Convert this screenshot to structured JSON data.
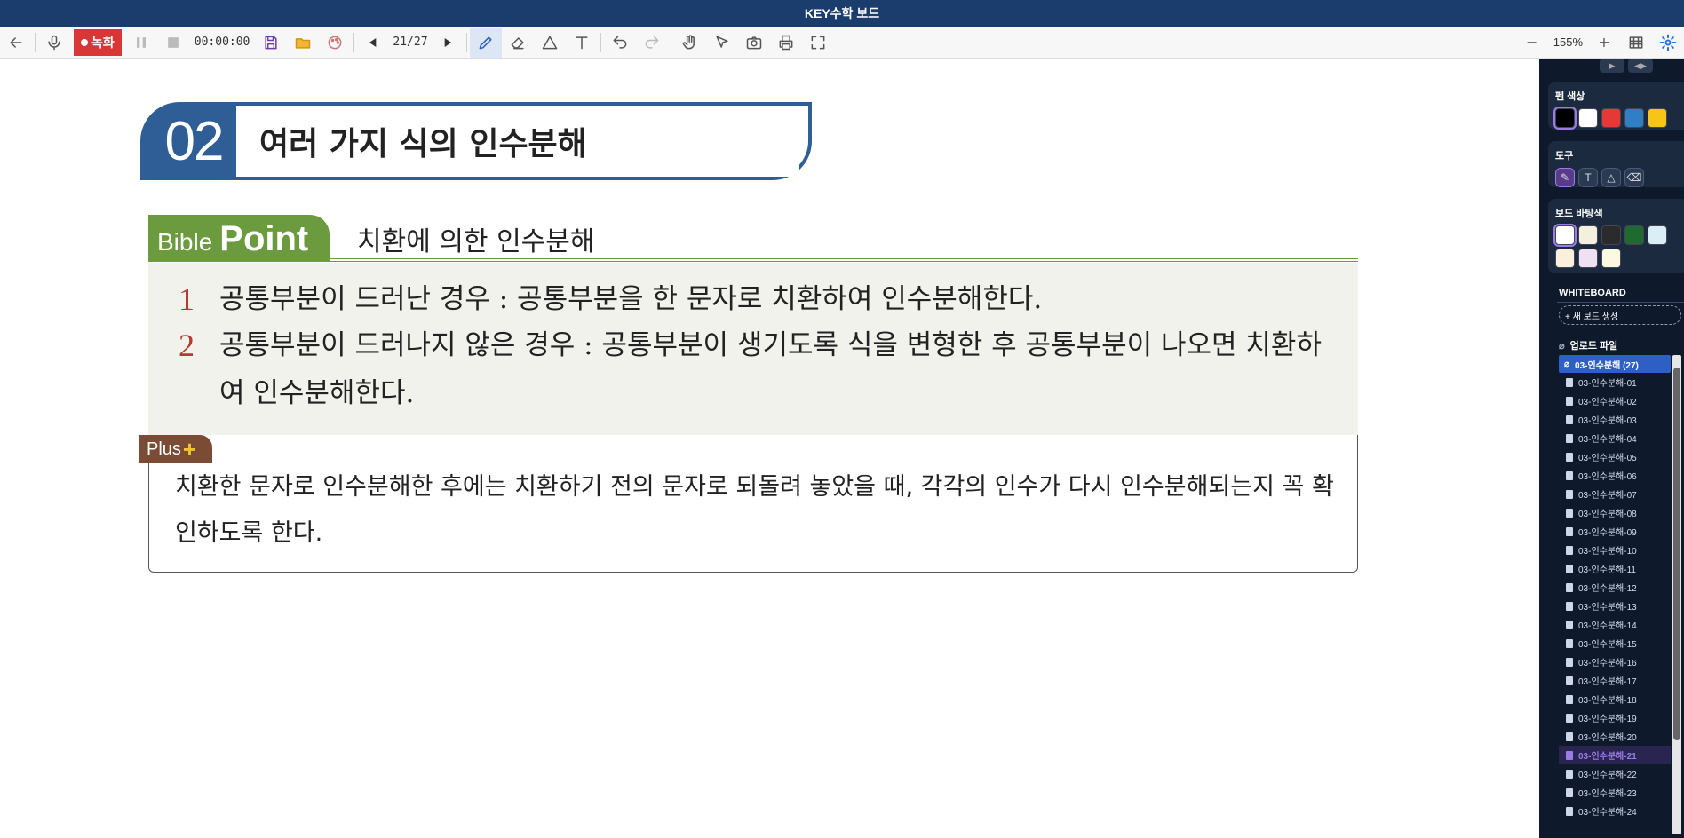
{
  "window": {
    "title": "KEY수학 보드"
  },
  "toolbar": {
    "record_label": "녹화",
    "timer": "00:00:00",
    "page": "21/27",
    "zoom": "155%",
    "zoom_out": "−",
    "zoom_in": "+"
  },
  "content": {
    "section_number": "02",
    "section_title": "여러 가지 식의 인수분해",
    "bible_word1": "Bible",
    "bible_word2": "Point",
    "subtitle": "치환에 의한 인수분해",
    "points": [
      {
        "num": "1",
        "text": "공통부분이 드러난 경우 : 공통부분을 한 문자로 치환하여 인수분해한다."
      },
      {
        "num": "2",
        "text": "공통부분이 드러나지 않은 경우 : 공통부분이 생기도록 식을 변형한 후 공통부분이 나오면 치환하여 인수분해한다."
      }
    ],
    "plus_label": "Plus",
    "plus_symbol": "+",
    "plus_text": "치환한 문자로 인수분해한 후에는 치환하기 전의 문자로 되돌려 놓았을 때, 각각의 인수가 다시 인수분해되는지 꼭 확인하도록 한다."
  },
  "sidebar": {
    "pen_color_title": "펜 색상",
    "pen_colors": [
      "#000000",
      "#ffffff",
      "#e53935",
      "#2f7fc4",
      "#f5c518"
    ],
    "tool_title": "도구",
    "board_bg_title": "보드 바탕색",
    "board_colors": [
      "#ffffff",
      "#f3f1de",
      "#2b2b2b",
      "#1f6b2f",
      "#dbeef6",
      "#fbf0dd",
      "#efe1f3",
      "#fdf8e1"
    ],
    "whiteboard_title": "WHITEBOARD",
    "new_board": "+ 새 보드 생성",
    "upload_title": "업로드 파일",
    "folder": "03-인수분해 (27)",
    "files": [
      "03-인수분해-01",
      "03-인수분해-02",
      "03-인수분해-03",
      "03-인수분해-04",
      "03-인수분해-05",
      "03-인수분해-06",
      "03-인수분해-07",
      "03-인수분해-08",
      "03-인수분해-09",
      "03-인수분해-10",
      "03-인수분해-11",
      "03-인수분해-12",
      "03-인수분해-13",
      "03-인수분해-14",
      "03-인수분해-15",
      "03-인수분해-16",
      "03-인수분해-17",
      "03-인수분해-18",
      "03-인수분해-19",
      "03-인수분해-20",
      "03-인수분해-21",
      "03-인수분해-22",
      "03-인수분해-23",
      "03-인수분해-24"
    ],
    "current_file_index": 20
  }
}
